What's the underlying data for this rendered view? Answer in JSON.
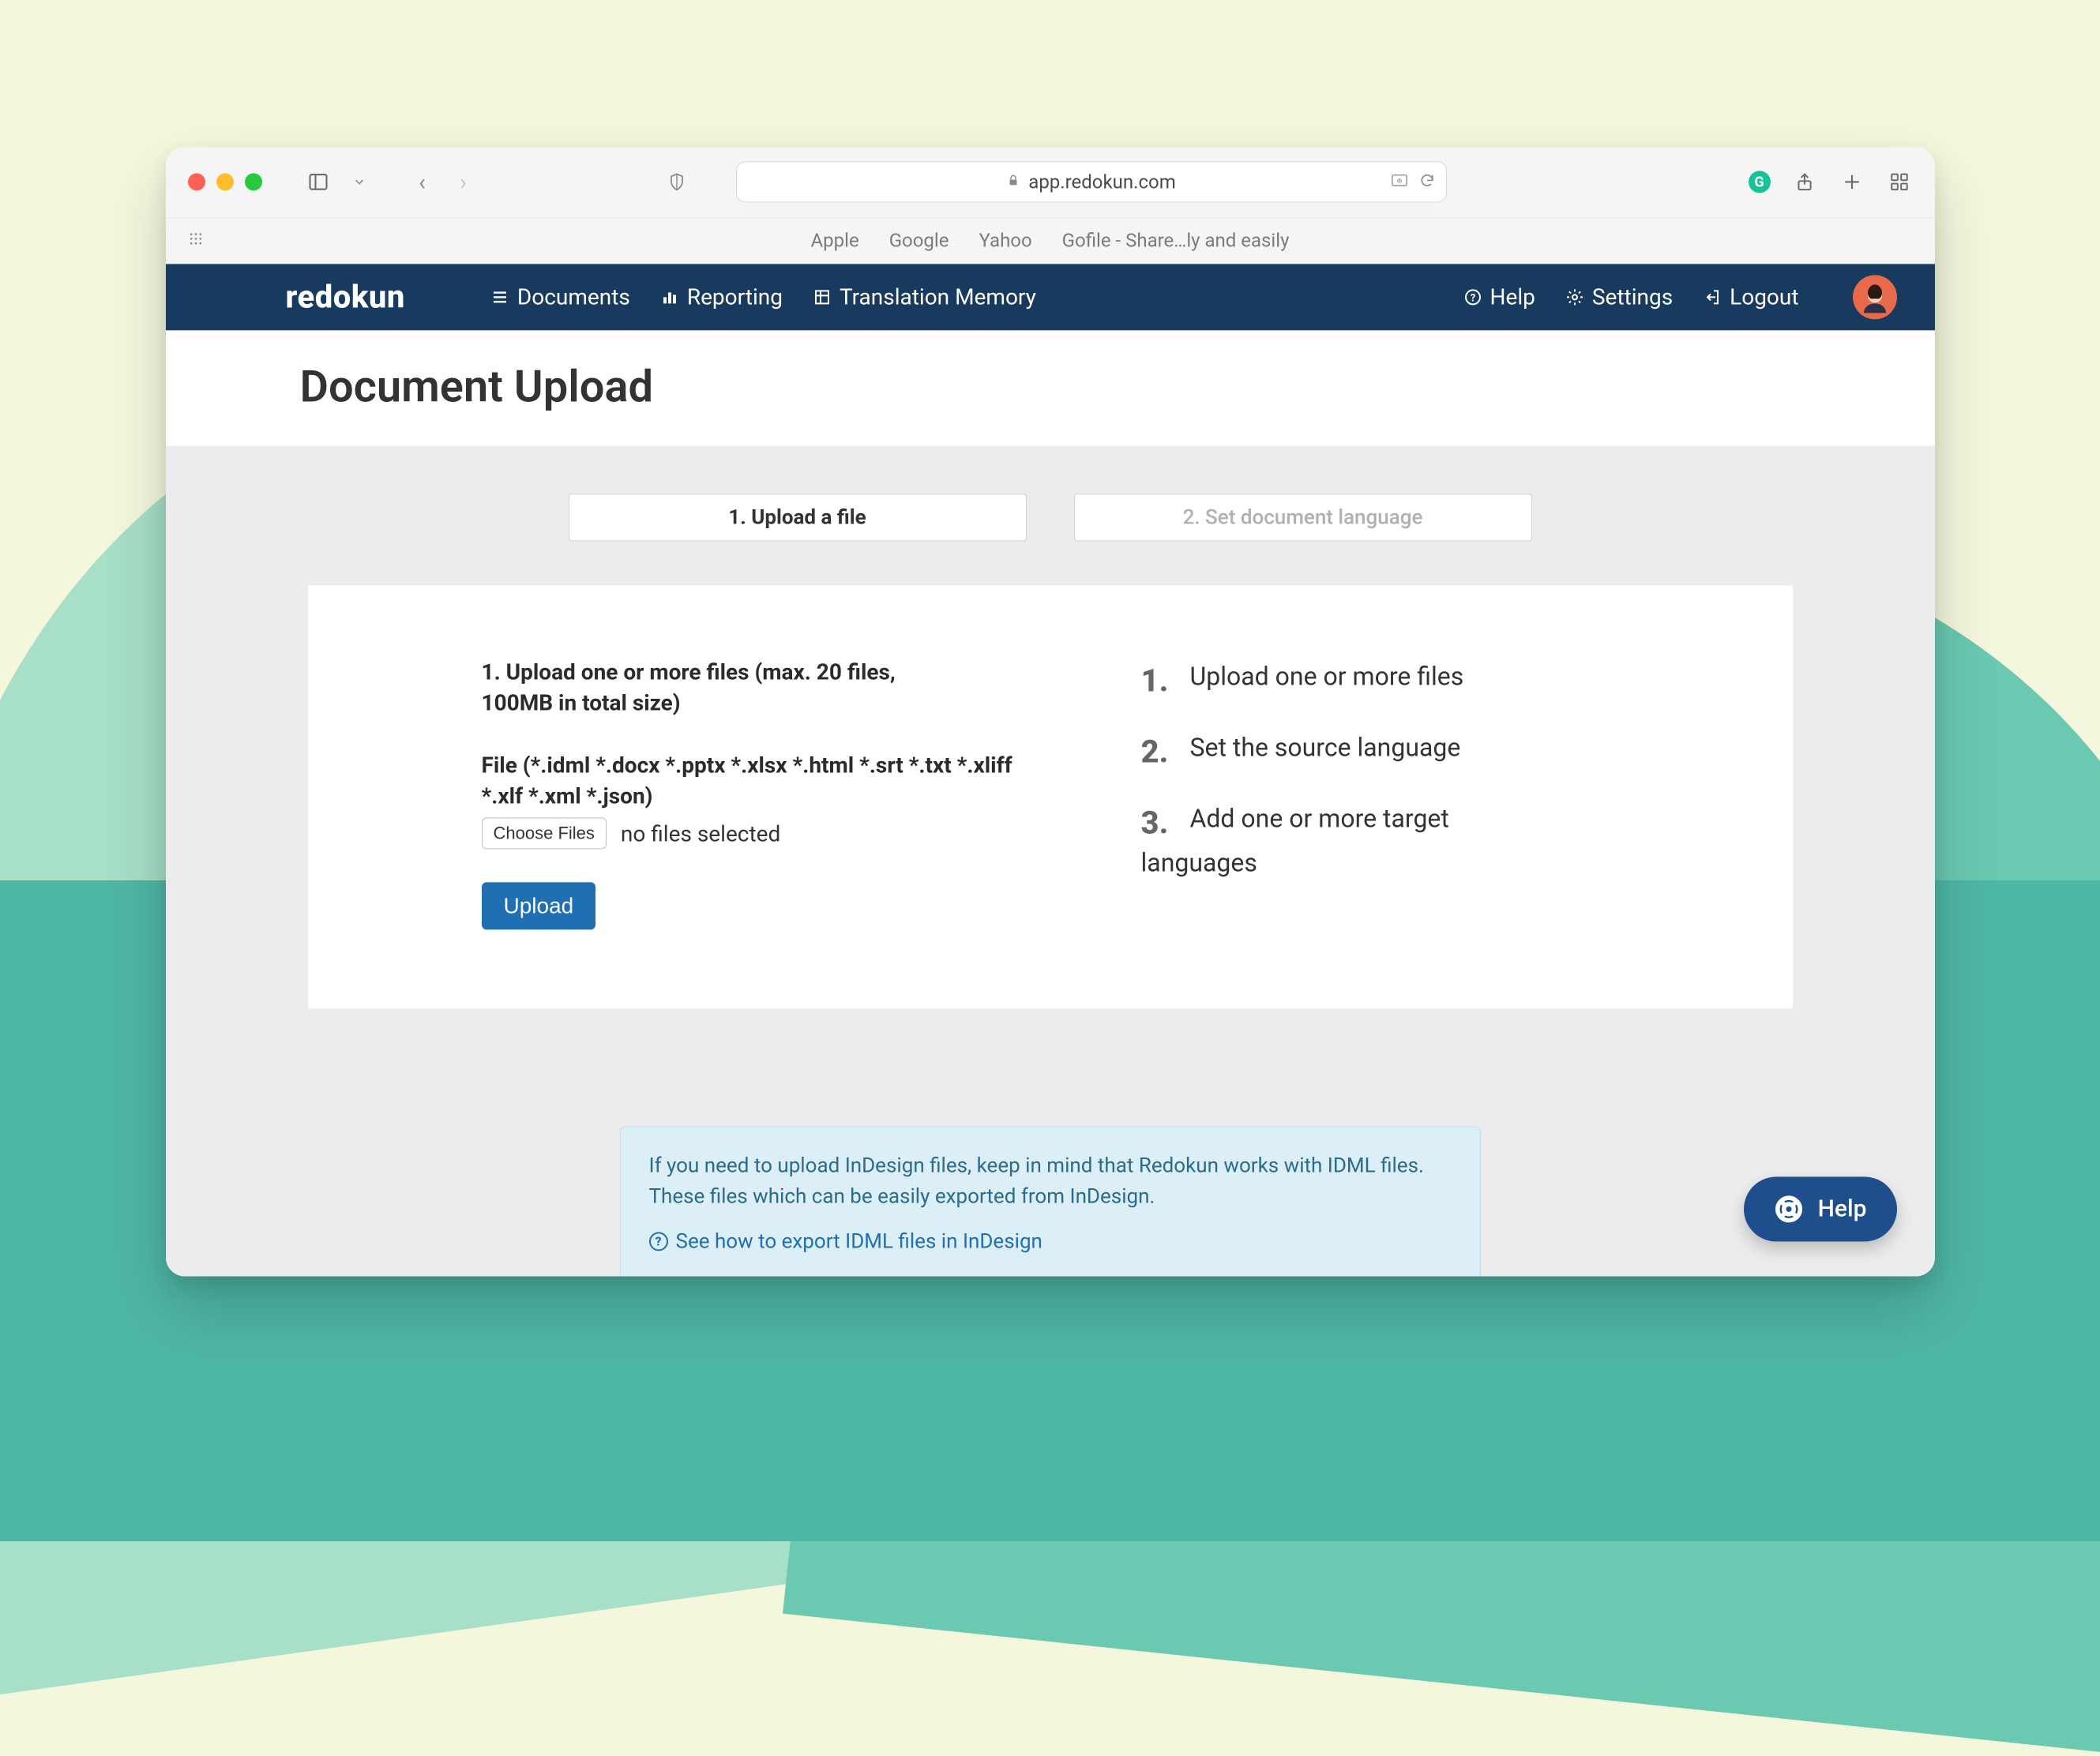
{
  "browser": {
    "url_host": "app.redokun.com",
    "bookmarks": {
      "apple": "Apple",
      "google": "Google",
      "yahoo": "Yahoo",
      "gofile": "Gofile - Share…ly and easily"
    }
  },
  "app_nav": {
    "logo": "redokun",
    "documents": "Documents",
    "reporting": "Reporting",
    "translation_memory": "Translation Memory",
    "help": "Help",
    "settings": "Settings",
    "logout": "Logout"
  },
  "page": {
    "title": "Document Upload"
  },
  "tabs": {
    "step1": "1. Upload a file",
    "step2": "2. Set document language"
  },
  "upload": {
    "heading": "1. Upload one or more files (max. 20 files, 100MB in total size)",
    "file_types": "File (*.idml *.docx *.pptx *.xlsx *.html *.srt *.txt *.xliff *.xlf *.xml *.json)",
    "choose_label": "Choose Files",
    "no_files": "no files selected",
    "button": "Upload"
  },
  "steps": {
    "s1_num": "1.",
    "s1_text": "Upload one or more files",
    "s2_num": "2.",
    "s2_text": "Set the source language",
    "s3_num": "3.",
    "s3_text": "Add one or more target",
    "s3_cont": "languages"
  },
  "info": {
    "text": "If you need to upload InDesign files, keep in mind that Redokun works with IDML files. These files which can be easily exported from InDesign.",
    "link": "See how to export IDML files in InDesign"
  },
  "help_widget": {
    "label": "Help"
  }
}
